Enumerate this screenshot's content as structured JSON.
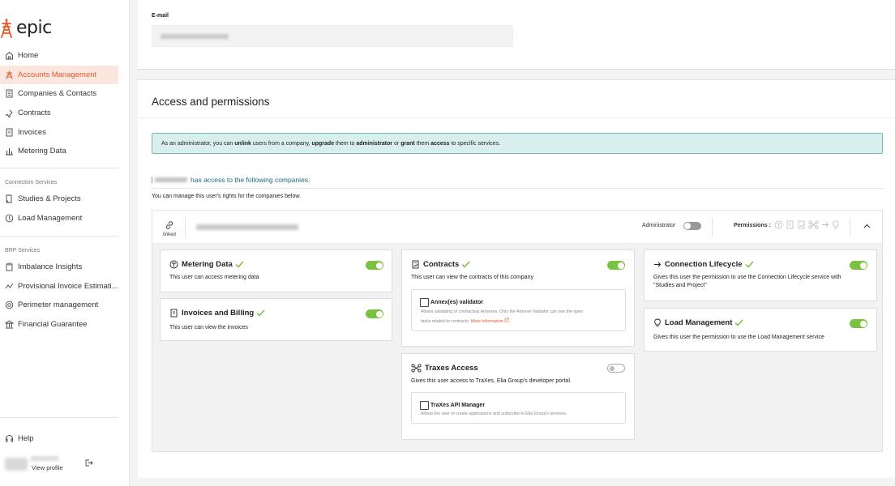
{
  "brand": {
    "name": "epic",
    "accent": "#e8592b"
  },
  "sidebar": {
    "main_items": [
      {
        "label": "Home",
        "icon": "home-icon",
        "active": false
      },
      {
        "label": "Accounts Management",
        "icon": "pylon-icon",
        "active": true
      },
      {
        "label": "Companies & Contacts",
        "icon": "building-icon",
        "active": false
      },
      {
        "label": "Contracts",
        "icon": "contract-icon",
        "active": false
      },
      {
        "label": "Invoices",
        "icon": "invoice-icon",
        "active": false
      },
      {
        "label": "Metering Data",
        "icon": "bar-chart-icon",
        "active": false
      }
    ],
    "connection_section": "Connection Services",
    "connection_items": [
      {
        "label": "Studies & Projects",
        "icon": "study-icon"
      },
      {
        "label": "Load Management",
        "icon": "load-icon"
      }
    ],
    "brp_section": "BRP Services",
    "brp_items": [
      {
        "label": "Imbalance Insights",
        "icon": "clipboard-icon"
      },
      {
        "label": "Provisional Invoice Estimati...",
        "icon": "trend-icon"
      },
      {
        "label": "Perimeter management",
        "icon": "target-icon"
      },
      {
        "label": "Financial Guarantee",
        "icon": "bank-icon"
      }
    ],
    "help": "Help",
    "profile_link": "View profile"
  },
  "user_form": {
    "email_label": "E-mail"
  },
  "access": {
    "title": "Access and permissions",
    "info_parts": [
      {
        "t": "As an administrator, you can ",
        "b": false
      },
      {
        "t": "unlink",
        "b": true
      },
      {
        "t": " users from a company, ",
        "b": false
      },
      {
        "t": "upgrade",
        "b": true
      },
      {
        "t": " them to ",
        "b": false
      },
      {
        "t": "administrator",
        "b": true
      },
      {
        "t": " or ",
        "b": false
      },
      {
        "t": "grant",
        "b": true
      },
      {
        "t": " them ",
        "b": false
      },
      {
        "t": "access",
        "b": true
      },
      {
        "t": " to specific services.",
        "b": false
      }
    ],
    "has_access": "has access to the following companies:",
    "manage_text": "You can manage this user's rights for the companies below."
  },
  "company": {
    "linked_label": "linked",
    "administrator_label": "Administrator",
    "administrator_on": false,
    "permissions_label": "Permissions :"
  },
  "services": {
    "metering": {
      "title": "Metering Data",
      "desc": "This user can access metering data",
      "enabled": true
    },
    "invoices": {
      "title": "Invoices and Billing",
      "desc": "This user can view the invoices",
      "enabled": true
    },
    "contracts": {
      "title": "Contracts",
      "desc": "This user can view the contracts of this company",
      "enabled": true,
      "sub_title": "Annex(es) validator",
      "sub_desc_1": "Allows validating of contractual Annexes. Only the Annexe Validator can see the open",
      "sub_desc_2": "tasks related to contracts.",
      "sub_more": "More information"
    },
    "traxes": {
      "title": "Traxes Access",
      "desc": "Gives this user access to TraXes, Elia Group's developer portal.",
      "enabled": false,
      "sub_title": "TraXes API Manager",
      "sub_desc": "Allows the user to create applications and subscribe to Elia Group's services."
    },
    "lifecycle": {
      "title": "Connection Lifecycle",
      "desc_1": "Gives this user the permission to use the Connection Lifecycle service with",
      "desc_2": "\"Studies and Project\"",
      "enabled": true
    },
    "load": {
      "title": "Load Management",
      "desc": "Gives this user the permission to use the Load Management service",
      "enabled": true
    }
  }
}
